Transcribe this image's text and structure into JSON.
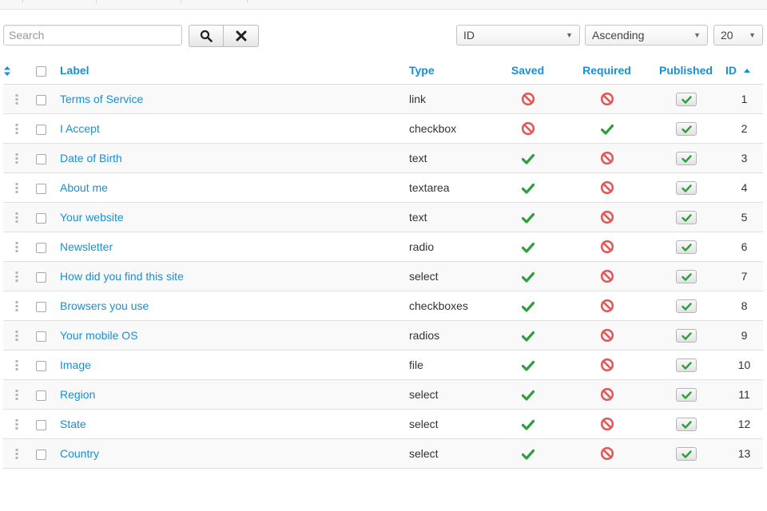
{
  "search": {
    "placeholder": "Search"
  },
  "list_controls": {
    "ordering": "ID",
    "direction": "Ascending",
    "limit": "20"
  },
  "table": {
    "headers": {
      "label": "Label",
      "type": "Type",
      "saved": "Saved",
      "required": "Required",
      "published": "Published",
      "id": "ID"
    },
    "rows": [
      {
        "label": "Terms of Service",
        "type": "link",
        "saved": false,
        "required": false,
        "published": true,
        "id": "1"
      },
      {
        "label": "I Accept",
        "type": "checkbox",
        "saved": false,
        "required": true,
        "published": true,
        "id": "2"
      },
      {
        "label": "Date of Birth",
        "type": "text",
        "saved": true,
        "required": false,
        "published": true,
        "id": "3"
      },
      {
        "label": "About me",
        "type": "textarea",
        "saved": true,
        "required": false,
        "published": true,
        "id": "4"
      },
      {
        "label": "Your website",
        "type": "text",
        "saved": true,
        "required": false,
        "published": true,
        "id": "5"
      },
      {
        "label": "Newsletter",
        "type": "radio",
        "saved": true,
        "required": false,
        "published": true,
        "id": "6"
      },
      {
        "label": "How did you find this site",
        "type": "select",
        "saved": true,
        "required": false,
        "published": true,
        "id": "7"
      },
      {
        "label": "Browsers you use",
        "type": "checkboxes",
        "saved": true,
        "required": false,
        "published": true,
        "id": "8"
      },
      {
        "label": "Your mobile OS",
        "type": "radios",
        "saved": true,
        "required": false,
        "published": true,
        "id": "9"
      },
      {
        "label": "Image",
        "type": "file",
        "saved": true,
        "required": false,
        "published": true,
        "id": "10"
      },
      {
        "label": "Region",
        "type": "select",
        "saved": true,
        "required": false,
        "published": true,
        "id": "11"
      },
      {
        "label": "State",
        "type": "select",
        "saved": true,
        "required": false,
        "published": true,
        "id": "12"
      },
      {
        "label": "Country",
        "type": "select",
        "saved": true,
        "required": false,
        "published": true,
        "id": "13"
      }
    ]
  },
  "colors": {
    "accent": "#1a8fd1",
    "check": "#2e9e3e",
    "forbidden": "#e05a5a"
  }
}
